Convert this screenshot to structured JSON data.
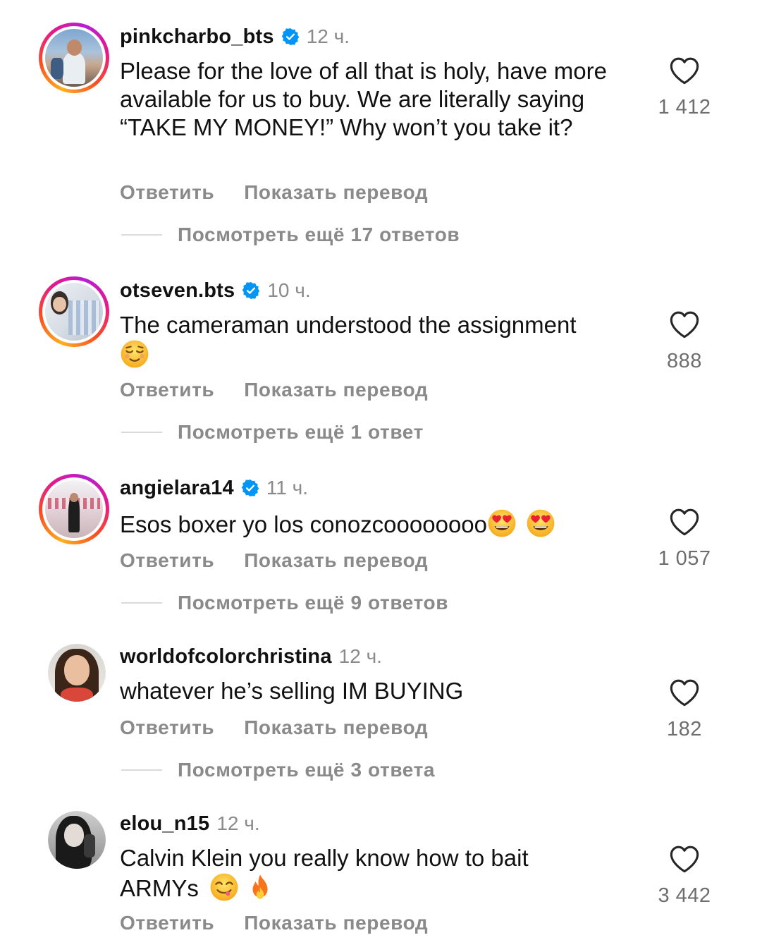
{
  "comments": [
    {
      "username": "pinkcharbo_bts",
      "verified": true,
      "time": "12 ч.",
      "text": "Please for the love of all that is holy, have more available for us to buy. We are literally saying “TAKE MY MONEY!” Why won’t you take it?",
      "likes": "1 412",
      "reply_label": "Ответить",
      "translate_label": "Показать перевод",
      "replies_label": "Посмотреть ещё 17 ответов",
      "avatar_story_ring": true
    },
    {
      "username": "otseven.bts",
      "verified": true,
      "time": "10 ч.",
      "text": "The cameraman understood the assignment",
      "emoji": [
        "relieved-face-emoji"
      ],
      "likes": "888",
      "reply_label": "Ответить",
      "translate_label": "Показать перевод",
      "replies_label": "Посмотреть ещё 1 ответ",
      "avatar_story_ring": true
    },
    {
      "username": "angielara14",
      "verified": true,
      "time": "11 ч.",
      "text": "Esos boxer yo los conozcoooooooo",
      "emoji": [
        "heart-eyes-emoji",
        "heart-eyes-emoji"
      ],
      "likes": "1 057",
      "reply_label": "Ответить",
      "translate_label": "Показать перевод",
      "replies_label": "Посмотреть ещё 9 ответов",
      "avatar_story_ring": true
    },
    {
      "username": "worldofcolorchristina",
      "verified": false,
      "time": "12 ч.",
      "text": "whatever he’s selling IM BUYING",
      "likes": "182",
      "reply_label": "Ответить",
      "translate_label": "Показать перевод",
      "replies_label": "Посмотреть ещё 3 ответа",
      "avatar_story_ring": false
    },
    {
      "username": "elou_n15",
      "verified": false,
      "time": "12 ч.",
      "text": "Calvin Klein you really know how to bait ARMYs",
      "emoji": [
        "yum-face-emoji",
        "fire-emoji"
      ],
      "likes": "3 442",
      "reply_label": "Ответить",
      "translate_label": "Показать перевод",
      "avatar_story_ring": false
    }
  ],
  "colors": {
    "username": "#111111",
    "secondary": "#8a8a8a",
    "verified_badge": "#0095f6",
    "divider": "#dbdbdb"
  }
}
